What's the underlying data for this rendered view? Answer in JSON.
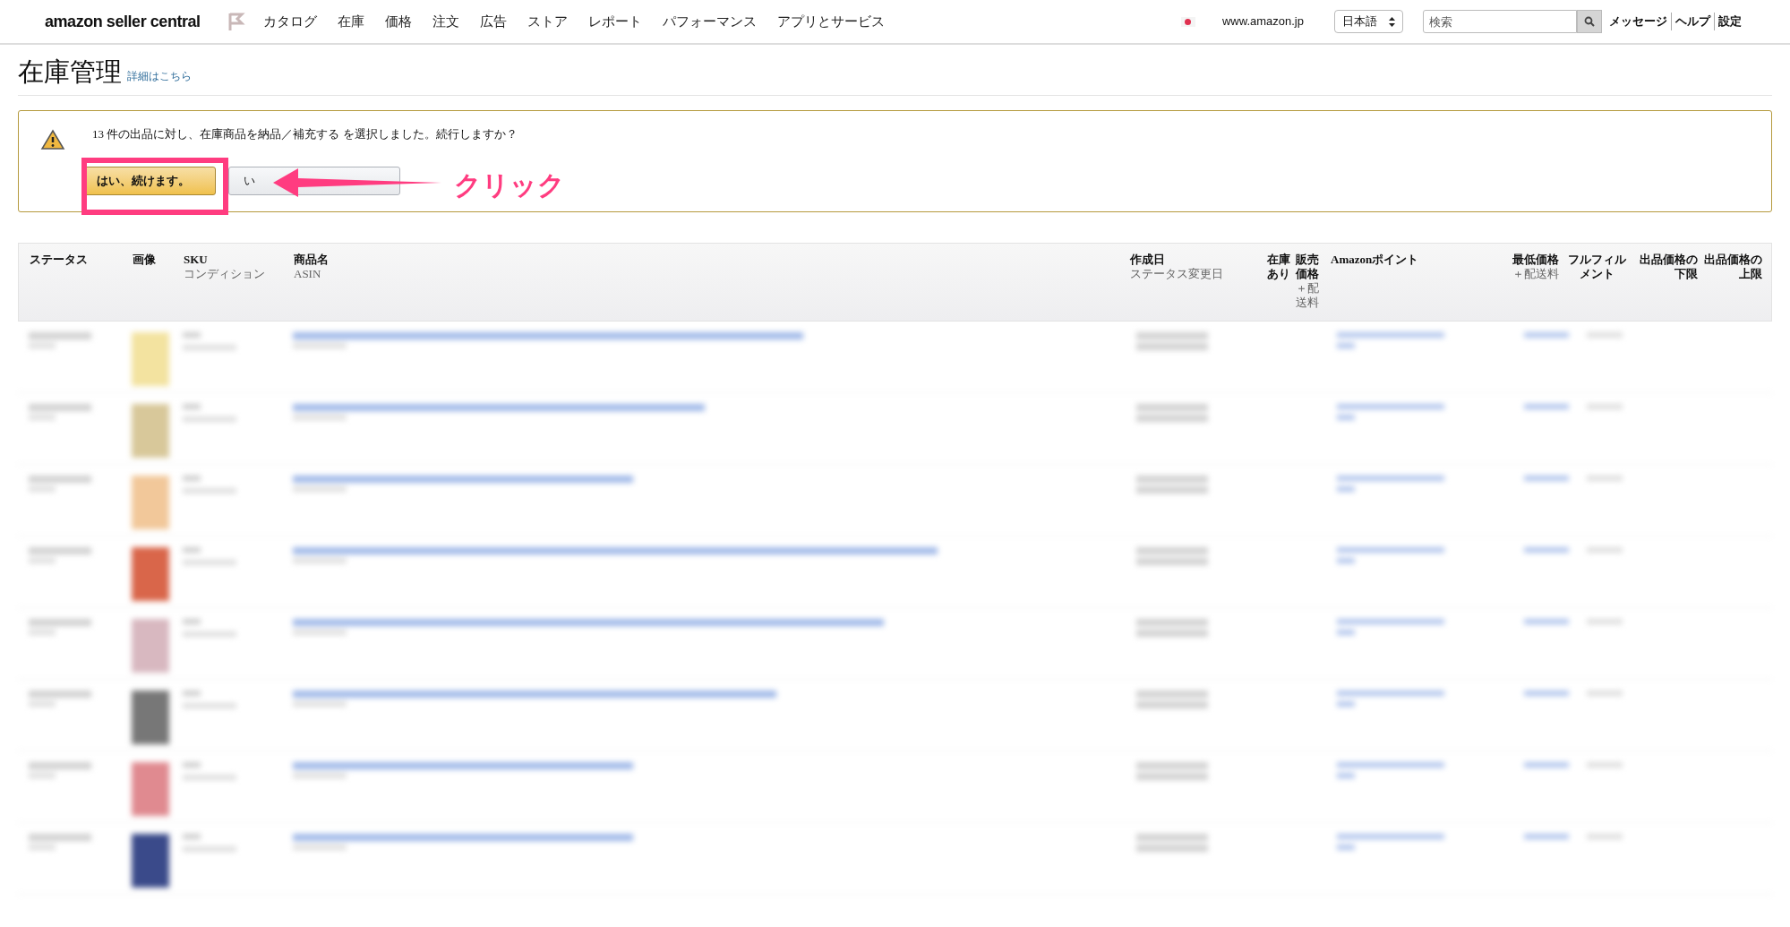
{
  "nav": {
    "logo": "amazon seller central",
    "menu": [
      "カタログ",
      "在庫",
      "価格",
      "注文",
      "広告",
      "ストア",
      "レポート",
      "パフォーマンス",
      "アプリとサービス"
    ],
    "marketplace": "www.amazon.jp",
    "language": "日本語",
    "search": {
      "placeholder": "検索"
    },
    "links": [
      "メッセージ",
      "ヘルプ",
      "設定"
    ]
  },
  "page": {
    "title": "在庫管理",
    "help_link": "詳細はこちら"
  },
  "alert": {
    "message": "13 件の出品に対し、在庫商品を納品／補充する を選択しました。続行しますか？",
    "buttons": [
      {
        "label": "はい、続けます。",
        "kind": "primary"
      },
      {
        "label": "い",
        "kind": "secondary"
      }
    ]
  },
  "annotation": {
    "label": "クリック"
  },
  "table": {
    "columns": [
      {
        "title": "ステータス"
      },
      {
        "title": "画像"
      },
      {
        "title": "SKU",
        "subtitle": "コンディション"
      },
      {
        "title": "商品名",
        "subtitle": "ASIN"
      },
      {
        "title": "作成日",
        "subtitle": "ステータス変更日"
      },
      {
        "title": "在庫あり"
      },
      {
        "title": "販売価格",
        "subtitle": "＋配送料"
      },
      {
        "title": "Amazonポイント"
      },
      {
        "title": "最低価格",
        "subtitle": "＋配送料"
      },
      {
        "title": "フルフィルメント"
      },
      {
        "title": "出品価格の下限"
      },
      {
        "title": "出品価格の上限"
      }
    ]
  }
}
